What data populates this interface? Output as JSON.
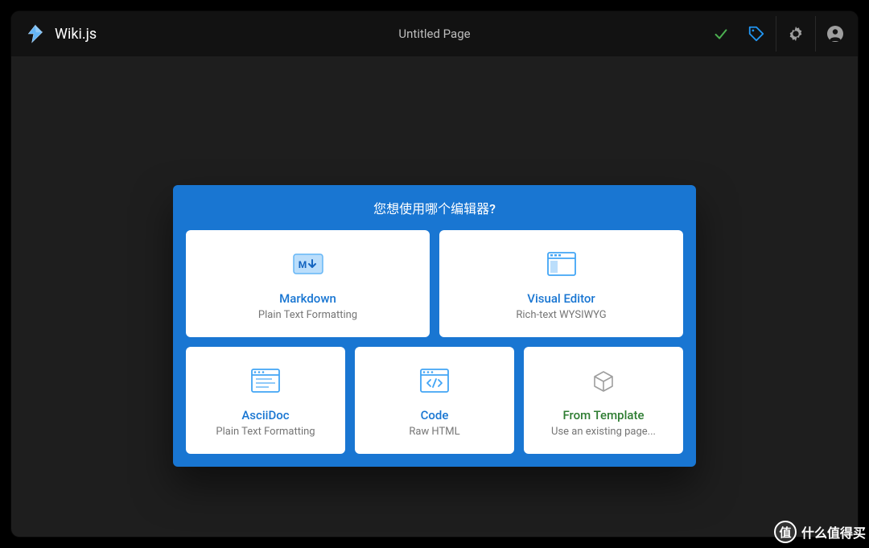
{
  "header": {
    "brand": "Wiki.js",
    "page_title": "Untitled Page"
  },
  "dialog": {
    "title": "您想使用哪个编辑器?",
    "options": [
      {
        "title": "Markdown",
        "subtitle": "Plain Text Formatting"
      },
      {
        "title": "Visual Editor",
        "subtitle": "Rich-text WYSIWYG"
      },
      {
        "title": "AsciiDoc",
        "subtitle": "Plain Text Formatting"
      },
      {
        "title": "Code",
        "subtitle": "Raw HTML"
      },
      {
        "title": "From Template",
        "subtitle": "Use an existing page..."
      }
    ]
  },
  "watermark": {
    "badge": "值",
    "text": "什么值得买"
  }
}
